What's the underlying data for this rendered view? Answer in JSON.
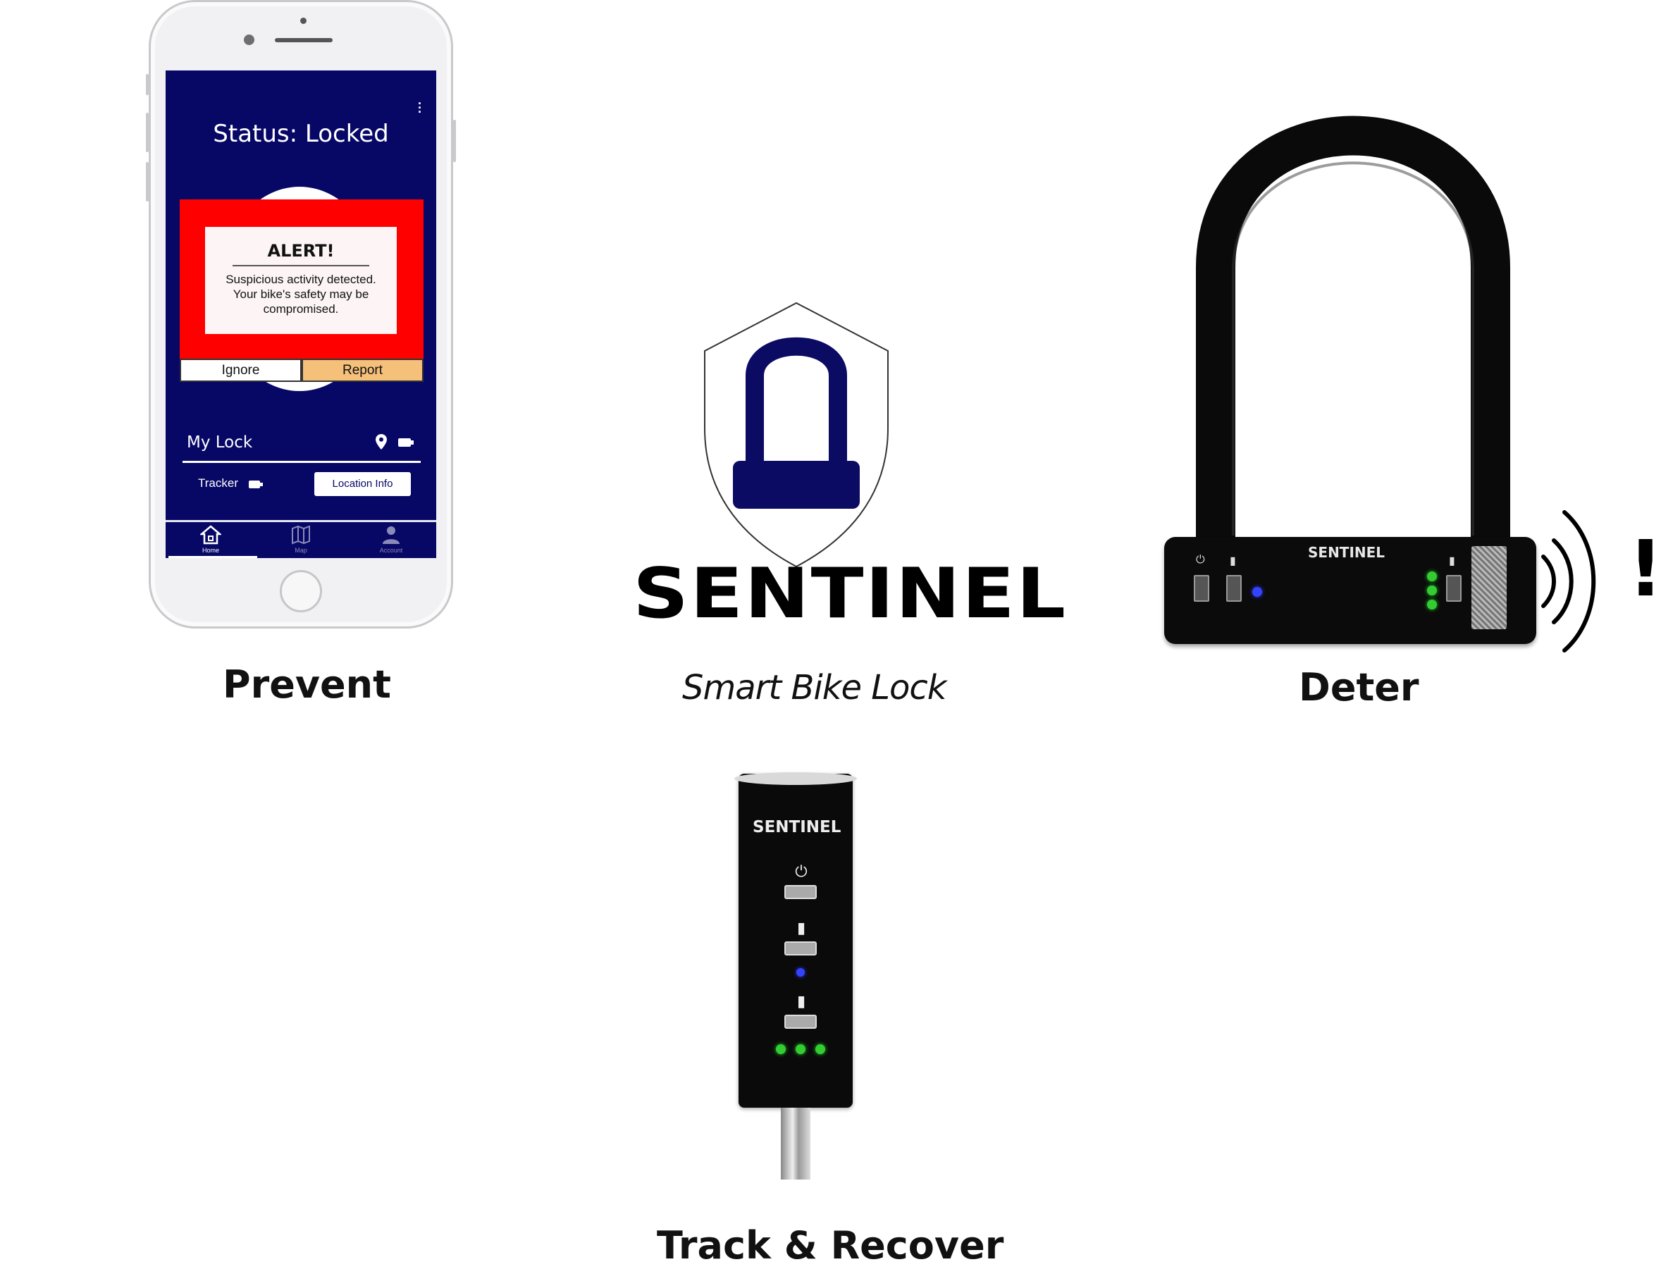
{
  "phone_app": {
    "status_title": "Status: Locked",
    "menu_icon": "kebab-menu-icon",
    "alert": {
      "title": "ALERT!",
      "message_line1": "Suspicious activity detected.",
      "message_line2": "Your bike's safety may be",
      "message_line3": "compromised.",
      "ignore_label": "Ignore",
      "report_label": "Report",
      "frame_color": "#ff0000",
      "report_color": "#f5c07a"
    },
    "my_lock": {
      "label": "My Lock",
      "location_icon": "map-pin-icon",
      "battery_icon": "battery-icon"
    },
    "tracker": {
      "label": "Tracker",
      "battery_icon": "battery-icon",
      "location_button": "Location Info"
    },
    "tabs": [
      {
        "label": "Home",
        "icon": "home-icon",
        "active": true
      },
      {
        "label": "Map",
        "icon": "map-icon",
        "active": false
      },
      {
        "label": "Account",
        "icon": "person-icon",
        "active": false
      }
    ],
    "background_color": "#070766"
  },
  "logo": {
    "brand": "SENTINEL",
    "tagline": "Smart Bike Lock",
    "emblem_icon": "shield-padlock-icon",
    "emblem_color": "#0b0b63"
  },
  "ulock": {
    "brand": "SENTINEL",
    "alarm_icon": "sound-waves-icon",
    "alarm_mark": "!"
  },
  "tracker_device": {
    "brand": "SENTINEL"
  },
  "captions": {
    "prevent": "Prevent",
    "deter": "Deter",
    "track_recover": "Track & Recover"
  }
}
